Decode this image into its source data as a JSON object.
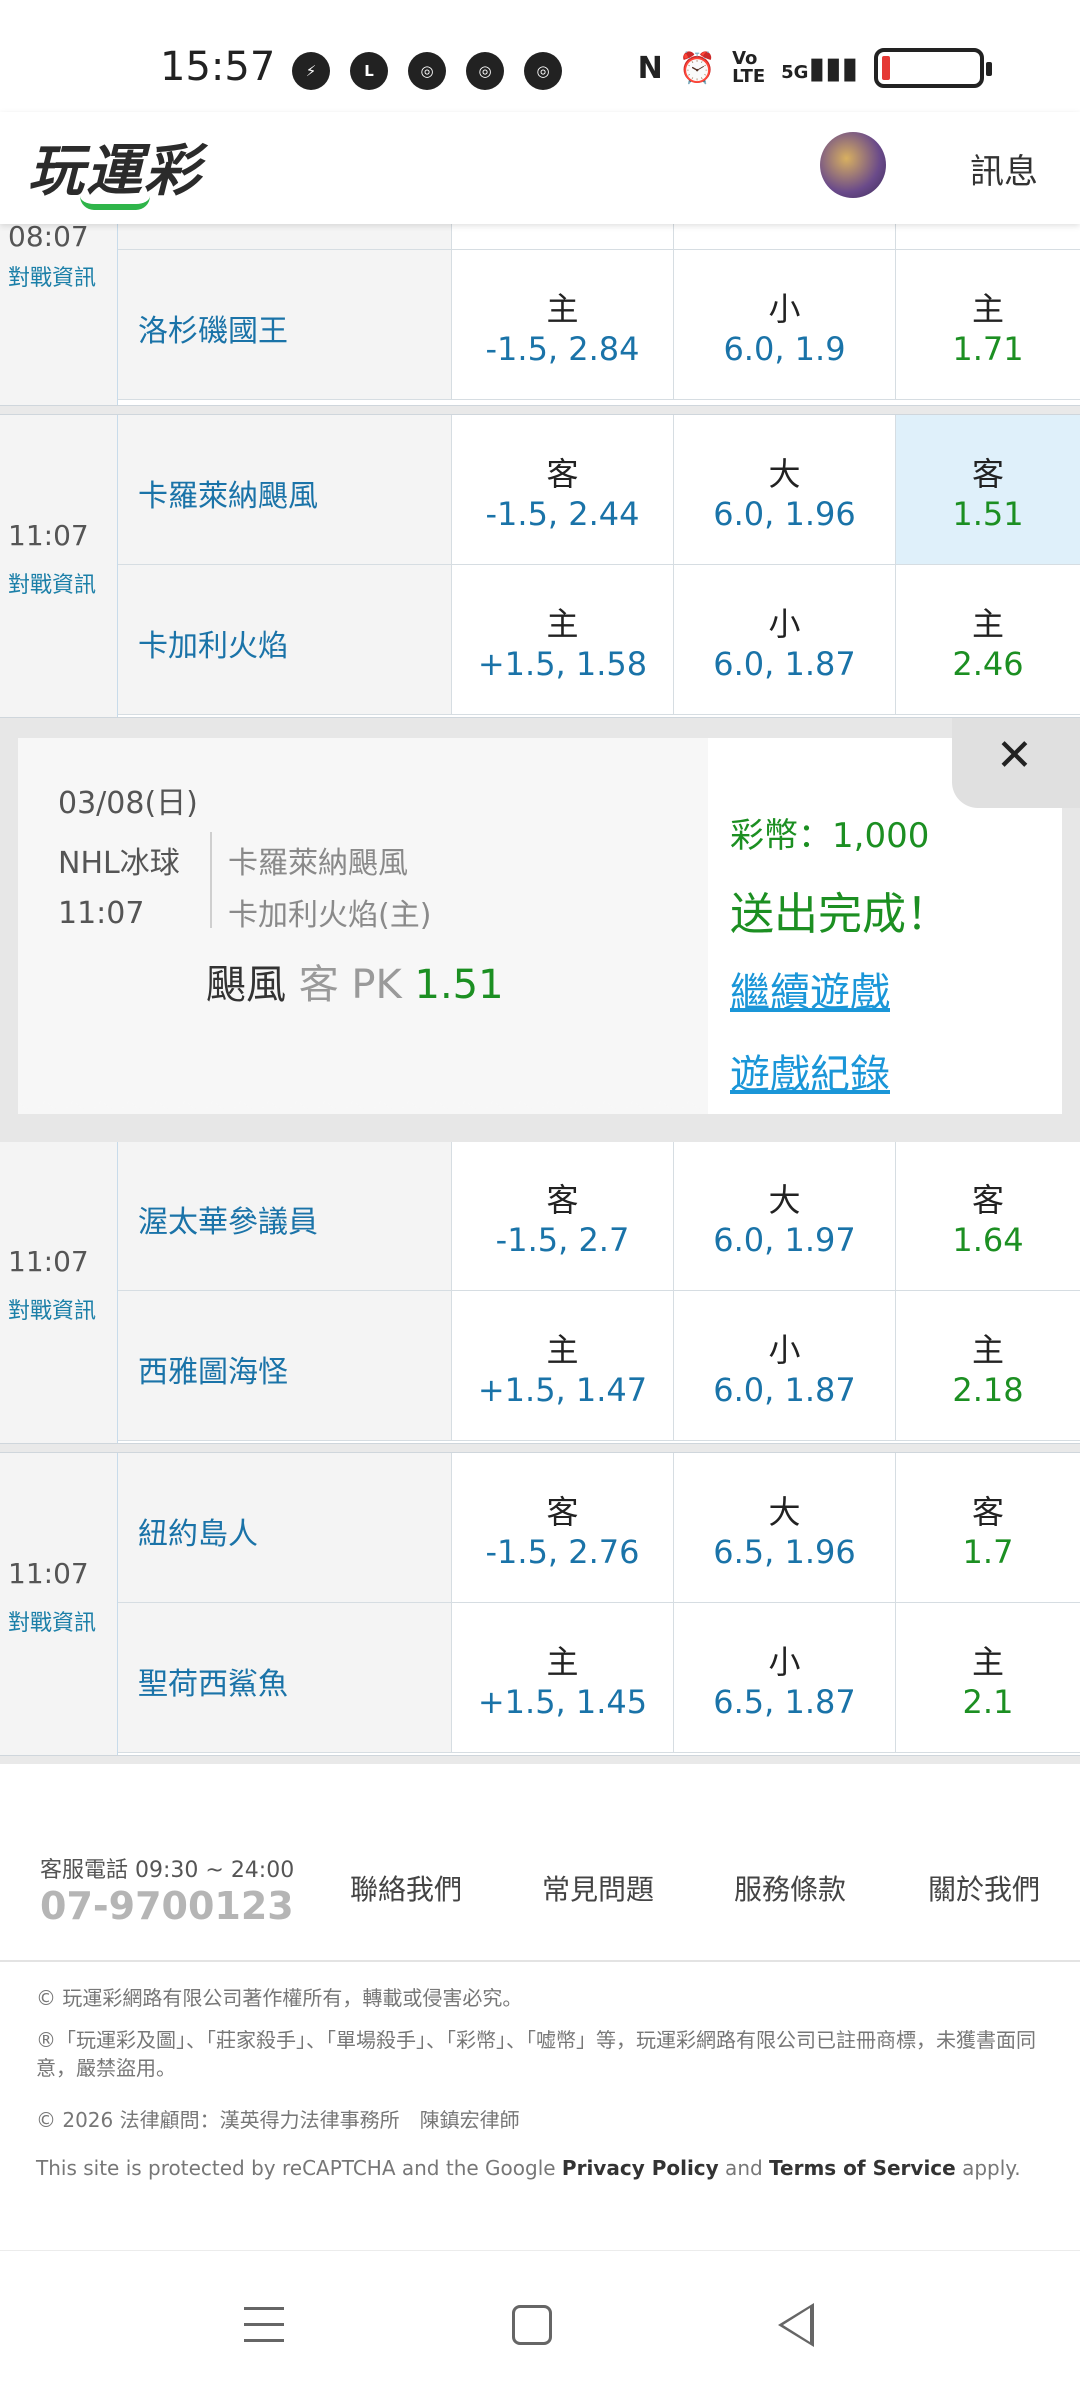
{
  "status": {
    "time": "15:57",
    "notif_icons": [
      "messenger-icon",
      "line-icon",
      "chrome-icon",
      "chrome-icon",
      "chrome-icon"
    ],
    "network": "5G"
  },
  "header": {
    "logo": "玩運彩",
    "messages": "訊息"
  },
  "groups": [
    {
      "time": "08:07",
      "info": "對戰資訊",
      "rows": [
        {
          "team": "洛杉磯國王",
          "spread_side": "主",
          "spread": "-1.5, 2.84",
          "total_side": "小",
          "total": "6.0, 1.9",
          "ml_side": "主",
          "ml": "1.71"
        }
      ]
    },
    {
      "time": "11:07",
      "info": "對戰資訊",
      "rows": [
        {
          "team": "卡羅萊納颶風",
          "spread_side": "客",
          "spread": "-1.5, 2.44",
          "total_side": "大",
          "total": "6.0, 1.96",
          "ml_side": "客",
          "ml": "1.51"
        },
        {
          "team": "卡加利火焰",
          "spread_side": "主",
          "spread": "+1.5, 1.58",
          "total_side": "小",
          "total": "6.0, 1.87",
          "ml_side": "主",
          "ml": "2.46"
        }
      ]
    },
    {
      "time": "11:07",
      "info": "對戰資訊",
      "rows": [
        {
          "team": "渥太華參議員",
          "spread_side": "客",
          "spread": "-1.5, 2.7",
          "total_side": "大",
          "total": "6.0, 1.97",
          "ml_side": "客",
          "ml": "1.64"
        },
        {
          "team": "西雅圖海怪",
          "spread_side": "主",
          "spread": "+1.5, 1.47",
          "total_side": "小",
          "total": "6.0, 1.87",
          "ml_side": "主",
          "ml": "2.18"
        }
      ]
    },
    {
      "time": "11:07",
      "info": "對戰資訊",
      "rows": [
        {
          "team": "紐約島人",
          "spread_side": "客",
          "spread": "-1.5, 2.76",
          "total_side": "大",
          "total": "6.5, 1.96",
          "ml_side": "客",
          "ml": "1.7"
        },
        {
          "team": "聖荷西鯊魚",
          "spread_side": "主",
          "spread": "+1.5, 1.45",
          "total_side": "小",
          "total": "6.5, 1.87",
          "ml_side": "主",
          "ml": "2.1"
        }
      ]
    }
  ],
  "popup": {
    "date": "03/08(日)",
    "sport": "NHL冰球",
    "time": "11:07",
    "team1": "卡羅萊納颶風",
    "team2": "卡加利火焰(主)",
    "bet_team": "颶風",
    "bet_type": "客 PK",
    "bet_odds": "1.51",
    "close": "✕",
    "coins": "彩幣：1,000",
    "done": "送出完成！",
    "continue": "繼續遊戲",
    "history": "遊戲紀錄"
  },
  "footer": {
    "hours": "客服電話 09:30 ~ 24:00",
    "phone": "07-9700123",
    "links": [
      "聯絡我們",
      "常見問題",
      "服務條款",
      "關於我們"
    ],
    "copyright": "© 玩運彩網路有限公司著作權所有，轉載或侵害必究。",
    "trademark": "®「玩運彩及圖」、「莊家殺手」、「單場殺手」、「彩幣」、「嘘幣」等，玩運彩網路有限公司已註冊商標，未獲書面同意，嚴禁盜用。",
    "legal": "© 2026 法律顧問：漢英得力法律事務所　陳鎮宏律師",
    "recaptcha_pre": "This site is protected by reCAPTCHA and the Google ",
    "privacy": "Privacy Policy",
    "and": " and ",
    "terms": "Terms of Service",
    "apply": " apply."
  },
  "colors": {
    "blue": "#1a73a8",
    "green": "#1c8f22",
    "link": "#1a96d8",
    "selected": "#dff0fa"
  }
}
